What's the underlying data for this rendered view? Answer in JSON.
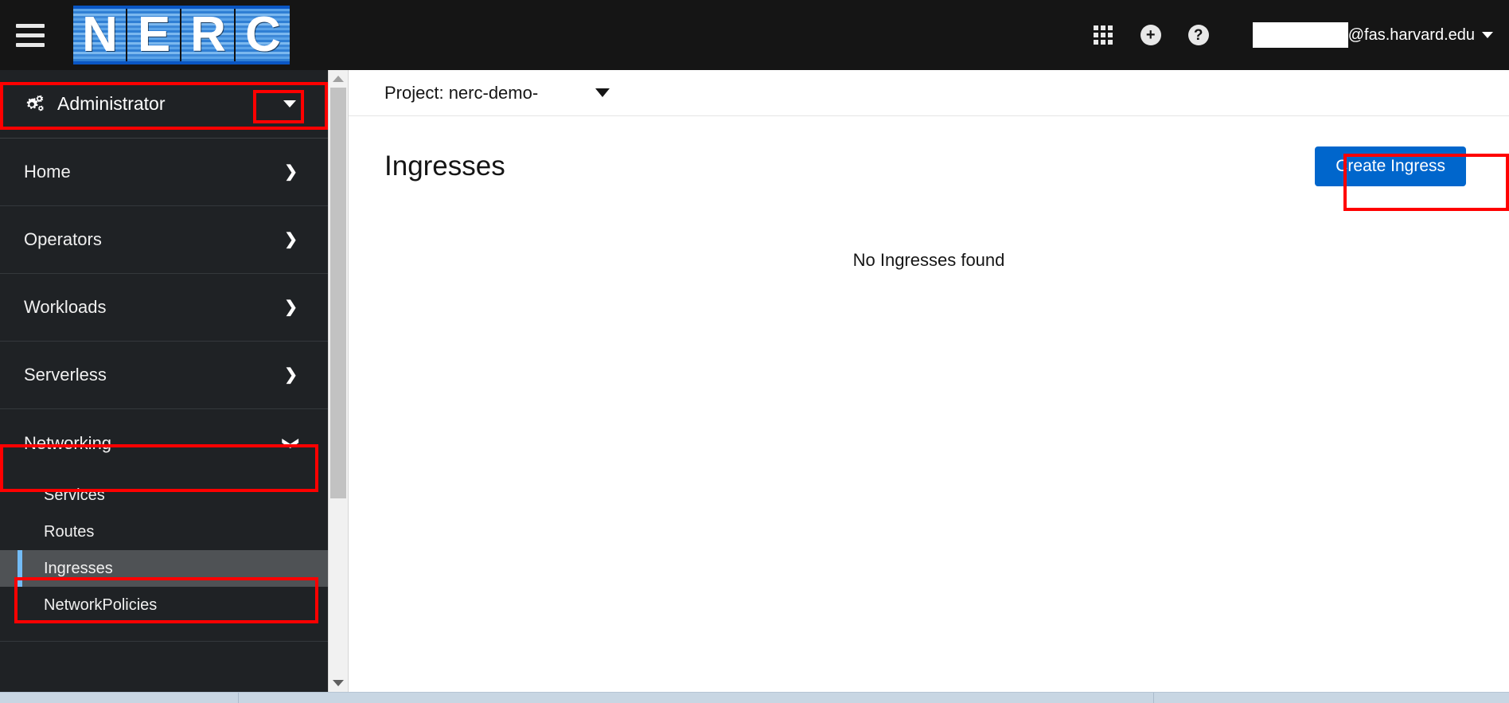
{
  "masthead": {
    "hamburger_name": "Navigation toggle",
    "logo_letters": [
      "N",
      "E",
      "R",
      "C"
    ],
    "icons": [
      {
        "name": "application-launcher-icon",
        "glyph": "grid"
      },
      {
        "name": "quick-add-icon",
        "glyph": "+"
      },
      {
        "name": "help-icon",
        "glyph": "?"
      }
    ],
    "user": {
      "redacted": "",
      "domain": "@fas.harvard.edu"
    }
  },
  "sidebar": {
    "perspective": {
      "label": "Administrator",
      "icon": "cogs-icon"
    },
    "nav": [
      {
        "label": "Home",
        "expandable": true,
        "expanded": false
      },
      {
        "label": "Operators",
        "expandable": true,
        "expanded": false
      },
      {
        "label": "Workloads",
        "expandable": true,
        "expanded": false
      },
      {
        "label": "Serverless",
        "expandable": true,
        "expanded": false
      },
      {
        "label": "Networking",
        "expandable": true,
        "expanded": true
      }
    ],
    "networking_children": [
      {
        "label": "Services",
        "selected": false
      },
      {
        "label": "Routes",
        "selected": false
      },
      {
        "label": "Ingresses",
        "selected": true
      },
      {
        "label": "NetworkPolicies",
        "selected": false
      }
    ]
  },
  "main": {
    "project_label": "Project: nerc-demo-",
    "page_title": "Ingresses",
    "create_button": "Create Ingress",
    "empty_message": "No Ingresses found"
  },
  "colors": {
    "masthead_bg": "#151515",
    "sidebar_bg": "#1f2225",
    "selected_item_bg": "#4f5255",
    "selected_accent": "#73bcf7",
    "primary_button": "#0066cc",
    "highlight_outline": "#ff0000",
    "logo_blue": "#2f7fd4"
  },
  "annotations": [
    {
      "name": "highlight-administrator",
      "target": "Administrator perspective switcher"
    },
    {
      "name": "highlight-administrator-caret",
      "target": "Administrator dropdown caret"
    },
    {
      "name": "highlight-networking",
      "target": "Networking nav item"
    },
    {
      "name": "highlight-ingresses",
      "target": "Ingresses sub nav item"
    },
    {
      "name": "highlight-create-ingress",
      "target": "Create Ingress button"
    }
  ]
}
